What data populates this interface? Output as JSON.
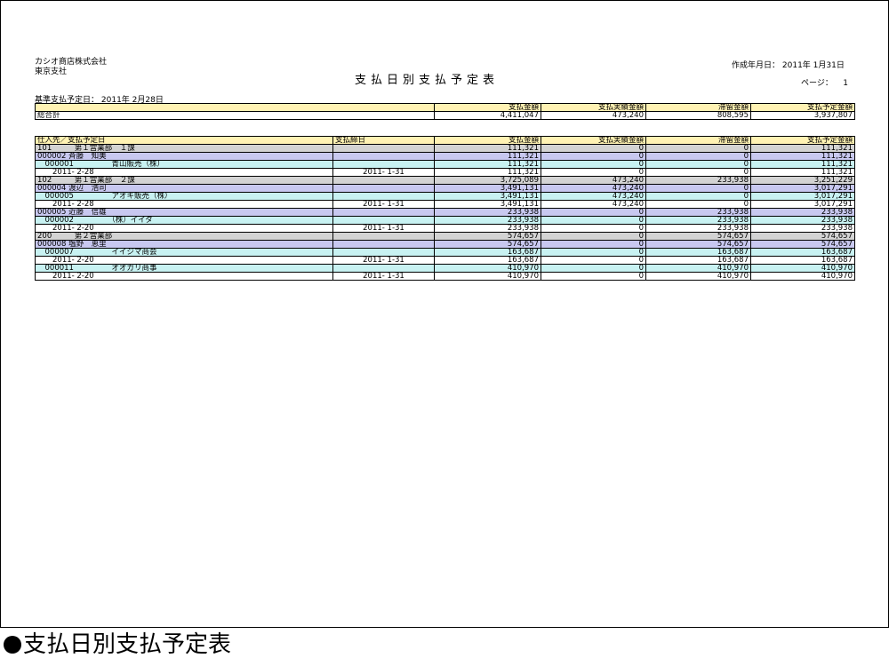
{
  "report": {
    "company": "カシオ商店株式会社",
    "branch": "東京支社",
    "title": "支払日別支払予定表",
    "created_label": "作成年月日：",
    "created_date": "2011年  1月31日",
    "page_label": "ページ：",
    "page_number": "1",
    "base_date_label": "基準支払予定日：",
    "base_date": "2011年  2月28日"
  },
  "summary": {
    "headers": [
      "",
      "支払金額",
      "支払実績金額",
      "滞留金額",
      "支払予定金額"
    ],
    "row": [
      "総合計",
      "4,411,047",
      "473,240",
      "808,595",
      "3,937,807"
    ]
  },
  "detail": {
    "headers": [
      "仕入先／支払予定日",
      "支払締日",
      "支払金額",
      "支払実績金額",
      "滞留金額",
      "支払予定金額"
    ],
    "rows": [
      {
        "level": "grp",
        "cells": [
          "101　　　第１営業部　１課",
          "",
          "111,321",
          "0",
          "0",
          "111,321"
        ]
      },
      {
        "level": "vend",
        "cells": [
          "000002 斉藤　知美",
          "",
          "111,321",
          "0",
          "0",
          "111,321"
        ]
      },
      {
        "level": "pay",
        "cells": [
          "　000001　　　　　青山販売（株）",
          "",
          "111,321",
          "0",
          "0",
          "111,321"
        ]
      },
      {
        "level": "date",
        "cells": [
          "　　2011- 2-28",
          "2011- 1-31",
          "111,321",
          "0",
          "0",
          "111,321"
        ]
      },
      {
        "level": "grp",
        "cells": [
          "102　　　第１営業部　２課",
          "",
          "3,725,089",
          "473,240",
          "233,938",
          "3,251,229"
        ]
      },
      {
        "level": "vend",
        "cells": [
          "000004 渡辺　浩司",
          "",
          "3,491,131",
          "473,240",
          "0",
          "3,017,291"
        ]
      },
      {
        "level": "pay",
        "cells": [
          "　000005　　　　　アオキ販売（株）",
          "",
          "3,491,131",
          "473,240",
          "0",
          "3,017,291"
        ]
      },
      {
        "level": "date",
        "cells": [
          "　　2011- 2-28",
          "2011- 1-31",
          "3,491,131",
          "473,240",
          "0",
          "3,017,291"
        ]
      },
      {
        "level": "vend",
        "cells": [
          "000005 近藤　信雄",
          "",
          "233,938",
          "0",
          "233,938",
          "233,938"
        ]
      },
      {
        "level": "pay",
        "cells": [
          "　000002　　　　　（株）イイダ",
          "",
          "233,938",
          "0",
          "233,938",
          "233,938"
        ]
      },
      {
        "level": "date",
        "cells": [
          "　　2011- 2-20",
          "2011- 1-31",
          "233,938",
          "0",
          "233,938",
          "233,938"
        ]
      },
      {
        "level": "grp",
        "cells": [
          "200　　　第２営業部",
          "",
          "574,657",
          "0",
          "574,657",
          "574,657"
        ]
      },
      {
        "level": "vend",
        "cells": [
          "000008 塩野　恵里",
          "",
          "574,657",
          "0",
          "574,657",
          "574,657"
        ]
      },
      {
        "level": "pay",
        "cells": [
          "　000007　　　　　イイジマ商会",
          "",
          "163,687",
          "0",
          "163,687",
          "163,687"
        ]
      },
      {
        "level": "date",
        "cells": [
          "　　2011- 2-20",
          "2011- 1-31",
          "163,687",
          "0",
          "163,687",
          "163,687"
        ]
      },
      {
        "level": "pay",
        "cells": [
          "　000011　　　　　オオガリ商事",
          "",
          "410,970",
          "0",
          "410,970",
          "410,970"
        ]
      },
      {
        "level": "date",
        "cells": [
          "　　2011- 2-20",
          "2011- 1-31",
          "410,970",
          "0",
          "410,970",
          "410,970"
        ]
      }
    ]
  },
  "caption": "支払日別支払予定表"
}
